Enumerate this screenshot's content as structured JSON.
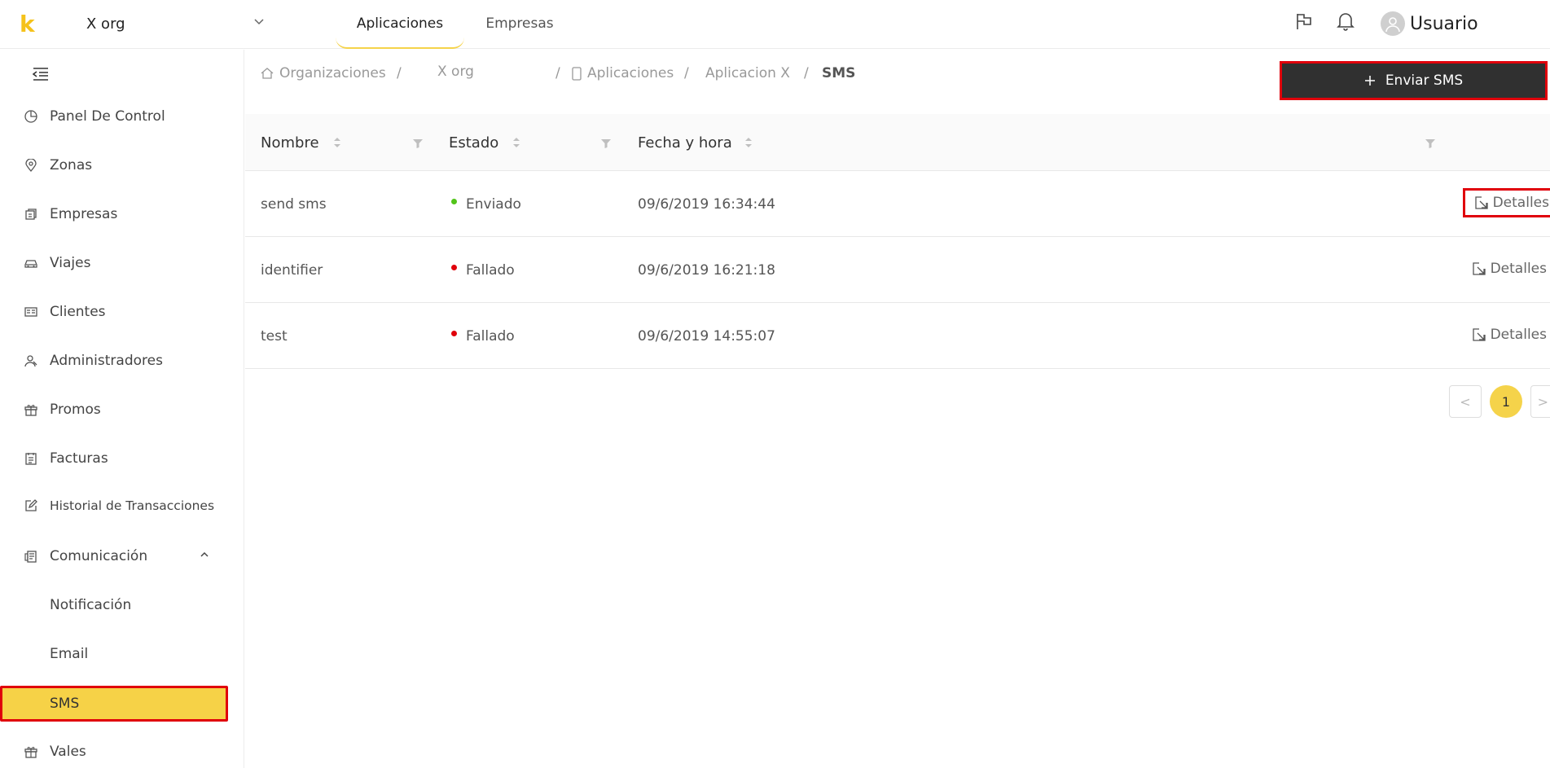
{
  "brand": {
    "logo_letter": "k",
    "logo_color": "#f5c21b"
  },
  "org_selector": {
    "value": "X org"
  },
  "top_tabs": [
    {
      "label": "Aplicaciones",
      "active": true
    },
    {
      "label": "Empresas",
      "active": false
    }
  ],
  "user": {
    "name": "Usuario"
  },
  "sidebar": {
    "items": [
      {
        "label": "Panel De Control",
        "icon": "pie-chart-icon"
      },
      {
        "label": "Zonas",
        "icon": "map-pin-icon"
      },
      {
        "label": "Empresas",
        "icon": "building-icon"
      },
      {
        "label": "Viajes",
        "icon": "car-icon"
      },
      {
        "label": "Clientes",
        "icon": "id-card-icon"
      },
      {
        "label": "Administradores",
        "icon": "users-icon"
      },
      {
        "label": "Promos",
        "icon": "gift-icon"
      },
      {
        "label": "Facturas",
        "icon": "invoice-icon"
      },
      {
        "label": "Historial de Transacciones",
        "icon": "edit-icon"
      },
      {
        "label": "Comunicación",
        "icon": "communication-icon",
        "expanded": true
      },
      {
        "label": "Notificación",
        "sub": true
      },
      {
        "label": "Email",
        "sub": true
      },
      {
        "label": "SMS",
        "sub": true,
        "selected": true
      },
      {
        "label": "Vales",
        "icon": "gift-icon"
      }
    ]
  },
  "breadcrumb": {
    "items": [
      "Organizaciones",
      "X org",
      "Aplicaciones",
      "Aplicacion X",
      "SMS"
    ],
    "separator": "/"
  },
  "send_button": {
    "label": "Enviar SMS"
  },
  "table": {
    "columns": [
      "Nombre",
      "Estado",
      "Fecha y hora"
    ],
    "rows": [
      {
        "nombre": "send sms",
        "estado": "Enviado",
        "estado_color": "#52c41a",
        "fecha": "09/6/2019 16:34:44",
        "action": "Detalles"
      },
      {
        "nombre": "identifier",
        "estado": "Fallado",
        "estado_color": "#e0000b",
        "fecha": "09/6/2019 16:21:18",
        "action": "Detalles"
      },
      {
        "nombre": "test",
        "estado": "Fallado",
        "estado_color": "#e0000b",
        "fecha": "09/6/2019 14:55:07",
        "action": "Detalles"
      }
    ]
  },
  "pagination": {
    "current": "1",
    "prev": "<",
    "next": ">"
  },
  "colors": {
    "accent": "#f5d34a",
    "highlight_border": "#e0000b",
    "button_dark": "#303030"
  }
}
